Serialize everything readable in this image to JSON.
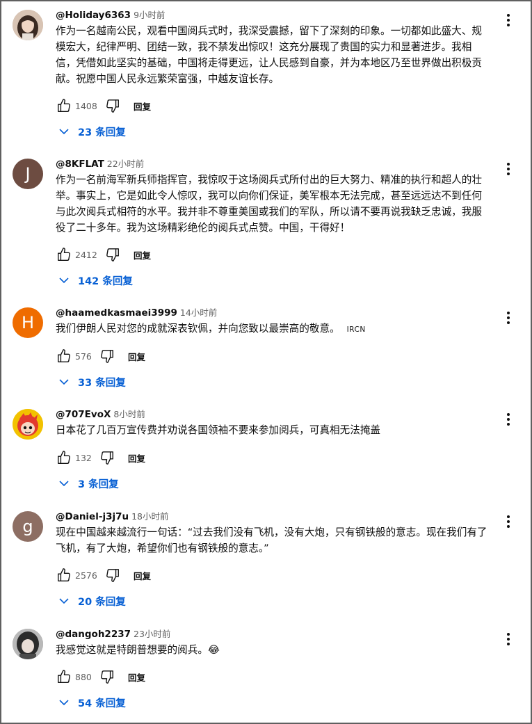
{
  "actions": {
    "reply_label": "回复"
  },
  "comments": [
    {
      "handle": "@Holiday6363",
      "time": "9小时前",
      "text": "作为一名越南公民，观看中国阅兵式时，我深受震撼，留下了深刻的印象。一切都如此盛大、规模宏大，纪律严明、团结一致，我不禁发出惊叹！这充分展现了贵国的实力和显著进步。我相信，凭借如此坚实的基础，中国将走得更远，让人民感到自豪，并为本地区乃至世界做出积极贡献。祝愿中国人民永远繁荣富强，中越友谊长存。",
      "likes": "1408",
      "replies": "23 条回复",
      "avatar": {
        "kind": "photo",
        "color": "#b58b6e"
      }
    },
    {
      "handle": "@8KFLAT",
      "time": "22小时前",
      "text": "作为一名前海军新兵师指挥官，我惊叹于这场阅兵式所付出的巨大努力、精准的执行和超人的壮举。事实上，它是如此令人惊叹，我可以向你们保证，美军根本无法完成，甚至远远达不到任何与此次阅兵式相符的水平。我并非不尊重美国或我们的军队，所以请不要再说我缺乏忠诚，我服役了二十多年。我为这场精彩绝伦的阅兵式点赞。中国，干得好！",
      "likes": "2412",
      "replies": "142 条回复",
      "avatar": {
        "kind": "letter",
        "letter": "J",
        "color": "#6d4c41"
      }
    },
    {
      "handle": "@haamedkasmaei3999",
      "time": "14小时前",
      "text": "我们伊朗人民对您的成就深表钦佩，并向您致以最崇高的敬意。",
      "tag": "IRCN",
      "likes": "576",
      "replies": "33 条回复",
      "avatar": {
        "kind": "letter",
        "letter": "H",
        "color": "#ef6c00"
      }
    },
    {
      "handle": "@707EvoX",
      "time": "8小时前",
      "text": "日本花了几百万宣传费并劝说各国领袖不要来参加阅兵，可真相无法掩盖",
      "likes": "132",
      "replies": "3 条回复",
      "avatar": {
        "kind": "cartoon",
        "color": "#f2c200"
      }
    },
    {
      "handle": "@Daniel-j3j7u",
      "time": "18小时前",
      "text": "现在中国越来越流行一句话：“过去我们没有飞机，没有大炮，只有钢铁般的意志。现在我们有了飞机，有了大炮，希望你们也有钢铁般的意志。”",
      "likes": "2576",
      "replies": "20 条回复",
      "avatar": {
        "kind": "letter",
        "letter": "g",
        "color": "#8d6e63"
      }
    },
    {
      "handle": "@dangoh2237",
      "time": "23小时前",
      "text": "我感觉这就是特朗普想要的阅兵。😂",
      "likes": "880",
      "replies": "54 条回复",
      "avatar": {
        "kind": "photo",
        "color": "#8a8a8a"
      }
    }
  ]
}
